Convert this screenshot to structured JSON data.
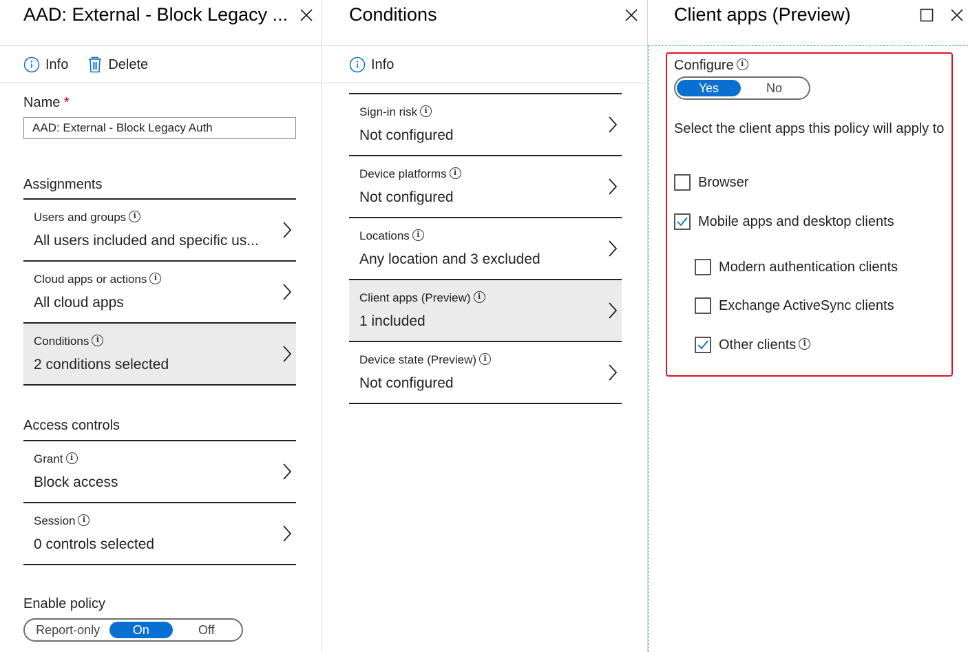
{
  "blade1": {
    "title": "AAD: External - Block Legacy ...",
    "commands": {
      "info": "Info",
      "delete": "Delete"
    },
    "name_label": "Name",
    "name_required": "*",
    "name_value": "AAD: External - Block Legacy Auth",
    "assignments_label": "Assignments",
    "assignments": [
      {
        "label": "Users and groups",
        "value": "All users included and specific us..."
      },
      {
        "label": "Cloud apps or actions",
        "value": "All cloud apps"
      },
      {
        "label": "Conditions",
        "value": "2 conditions selected"
      }
    ],
    "access_controls_label": "Access controls",
    "access_controls": [
      {
        "label": "Grant",
        "value": "Block access"
      },
      {
        "label": "Session",
        "value": "0 controls selected"
      }
    ],
    "enable_policy_label": "Enable policy",
    "enable_policy_options": [
      "Report-only",
      "On",
      "Off"
    ],
    "enable_policy_selected": "On"
  },
  "blade2": {
    "title": "Conditions",
    "commands": {
      "info": "Info"
    },
    "items": [
      {
        "label": "Sign-in risk",
        "value": "Not configured"
      },
      {
        "label": "Device platforms",
        "value": "Not configured"
      },
      {
        "label": "Locations",
        "value": "Any location and 3 excluded"
      },
      {
        "label": "Client apps (Preview)",
        "value": "1 included"
      },
      {
        "label": "Device state (Preview)",
        "value": "Not configured"
      }
    ]
  },
  "blade3": {
    "title": "Client apps (Preview)",
    "configure_label": "Configure",
    "configure_options": [
      "Yes",
      "No"
    ],
    "configure_selected": "Yes",
    "description": "Select the client apps this policy will apply to",
    "checkboxes": [
      {
        "label": "Browser",
        "checked": false
      },
      {
        "label": "Mobile apps and desktop clients",
        "checked": true
      },
      {
        "label": "Modern authentication clients",
        "checked": false
      },
      {
        "label": "Exchange ActiveSync clients",
        "checked": false
      },
      {
        "label": "Other clients",
        "checked": true
      }
    ]
  },
  "colors": {
    "accent": "#0a6fd2",
    "highlight": "#e0101e",
    "selected_row": "#ebebeb"
  }
}
